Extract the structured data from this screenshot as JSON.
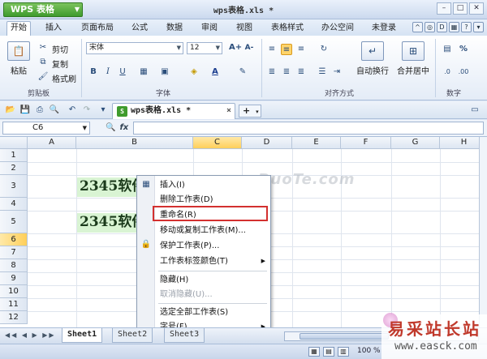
{
  "app": {
    "name": "WPS 表格",
    "window_title": "wps表格.xls *",
    "window_controls": [
      "–",
      "□",
      "✕"
    ]
  },
  "menu": {
    "tabs": [
      "开始",
      "插入",
      "页面布局",
      "公式",
      "数据",
      "审阅",
      "视图",
      "表格样式",
      "办公空间"
    ],
    "active": "开始",
    "login": "未登录"
  },
  "ribbon": {
    "paste": "粘贴",
    "cut": "剪切",
    "copy": "复制",
    "format_painter": "格式刷",
    "clipboard_label": "剪贴板",
    "font_name": "宋体",
    "font_size": "12",
    "font_label": "字体",
    "wrap_text": "自动换行",
    "merge_center": "合并居中",
    "align_label": "对齐方式",
    "number_label": "数字",
    "bold": "B",
    "italic": "I",
    "underline": "U",
    "grow_font": "A+",
    "shrink_font": "A-"
  },
  "document": {
    "tab_name": "wps表格.xls *",
    "close": "×",
    "add": "+"
  },
  "formula_bar": {
    "cell_ref": "C6",
    "fx_label": "fx",
    "value": ""
  },
  "grid": {
    "columns": [
      "A",
      "B",
      "C",
      "D",
      "E",
      "F",
      "G",
      "H"
    ],
    "selected_column": "C",
    "rows": [
      "1",
      "2",
      "3",
      "4",
      "5",
      "6",
      "7",
      "8",
      "9",
      "10",
      "11",
      "12"
    ],
    "selected_row": "6",
    "cell_B3": "2345软件",
    "cell_B5": "2345软件",
    "watermark": "www.DuoTe.com"
  },
  "context_menu": {
    "items": [
      {
        "label": "插入(I)",
        "disabled": false,
        "submenu": false
      },
      {
        "label": "删除工作表(D)",
        "disabled": false,
        "submenu": false
      },
      {
        "label": "重命名(R)",
        "disabled": false,
        "submenu": false
      },
      {
        "label": "移动或复制工作表(M)...",
        "disabled": false,
        "submenu": false
      },
      {
        "label": "保护工作表(P)...",
        "disabled": false,
        "submenu": false
      },
      {
        "label": "工作表标签颜色(T)",
        "disabled": false,
        "submenu": true
      },
      {
        "label": "隐藏(H)",
        "disabled": false,
        "submenu": false
      },
      {
        "label": "取消隐藏(U)...",
        "disabled": true,
        "submenu": false
      },
      {
        "label": "选定全部工作表(S)",
        "disabled": false,
        "submenu": false
      },
      {
        "label": "字号(F)",
        "disabled": false,
        "submenu": true
      }
    ],
    "highlighted": "重命名(R)"
  },
  "sheets": {
    "tabs": [
      "Sheet1",
      "Sheet2",
      "Sheet3"
    ],
    "active": "Sheet1"
  },
  "status": {
    "zoom": "100 %"
  },
  "site_watermark": {
    "text": "易采站长站",
    "url": "www.easck.com"
  },
  "colors": {
    "accent_green": "#3f9b2d",
    "highlight_red": "#d3302f",
    "cell_fill": "#d9f4d3",
    "selection_header": "#ffcf5a"
  }
}
